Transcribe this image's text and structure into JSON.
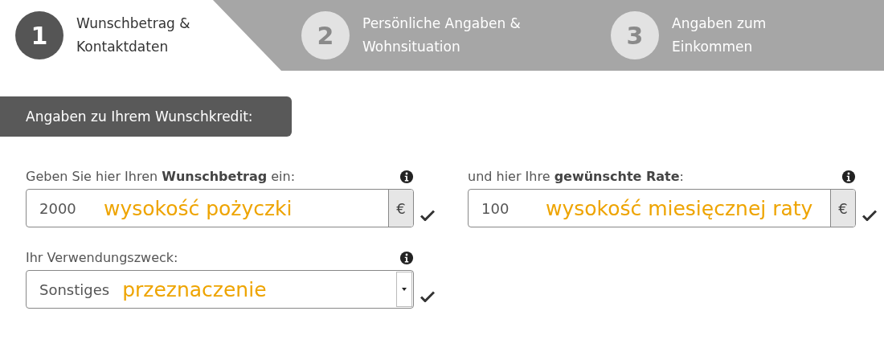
{
  "steps": [
    {
      "number": "1",
      "label": "Wunschbetrag & Kontaktdaten",
      "selected": true
    },
    {
      "number": "2",
      "label": "Persönliche Angaben & Wohnsituation",
      "selected": false
    },
    {
      "number": "3",
      "label": "Angaben zum Einkommen",
      "selected": false
    }
  ],
  "section_title": "Angaben zu Ihrem Wunschkredit:",
  "fields": [
    {
      "kind": "input",
      "label": "Geben Sie hier Ihren **Wunschbetrag** ein:",
      "value": "2000",
      "addon": "€",
      "annotation": "wysokość pożyczki",
      "valid": true
    },
    {
      "kind": "input",
      "label": "und hier Ihre **gewünschte Rate**:",
      "value": "100",
      "addon": "€",
      "annotation": "wysokość miesięcznej raty",
      "valid": true
    },
    {
      "kind": "select",
      "label": "Ihr Verwendungszweck:",
      "value": "Sonstiges",
      "annotation": "przeznaczenie",
      "valid": true
    }
  ]
}
